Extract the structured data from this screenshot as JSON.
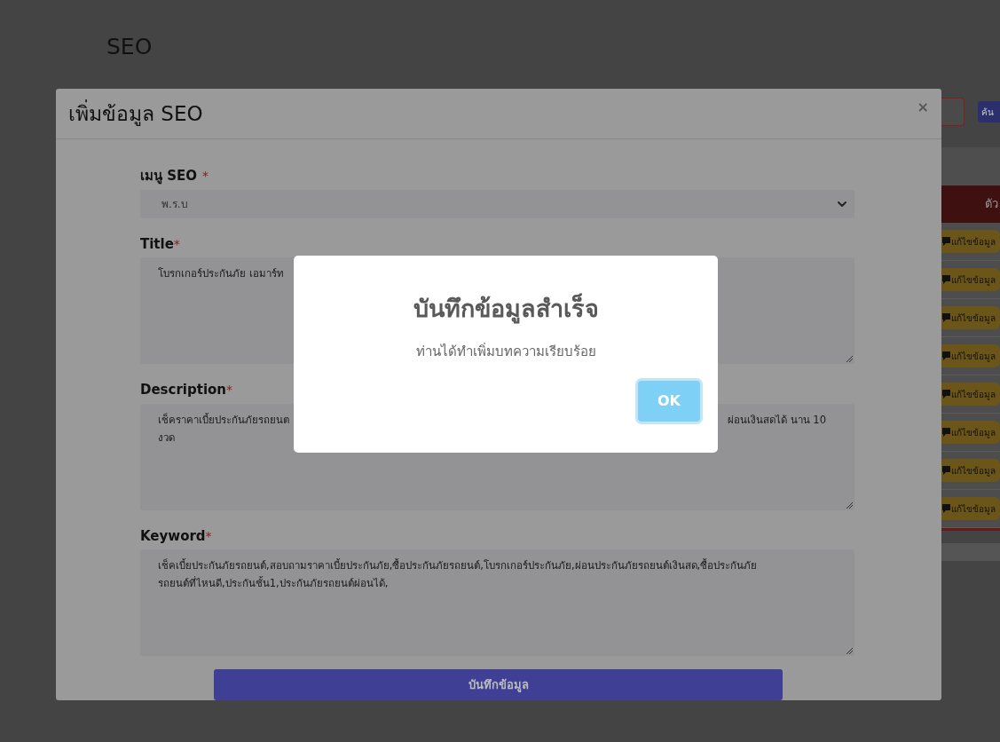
{
  "page": {
    "title": "SEO",
    "search_button": "ค้น",
    "table_header": "ตัว",
    "row_buttons": [
      "แก้ไขข้อมูล",
      "แก้ไขข้อมูล",
      "แก้ไขข้อมูล",
      "แก้ไขข้อมูล",
      "แก้ไขข้อมูล",
      "แก้ไขข้อมูล",
      "แก้ไขข้อมูล",
      "แก้ไขข้อมูล"
    ]
  },
  "modal": {
    "title": "เพิ่มข้อมูล SEO",
    "close": "×",
    "fields": [
      {
        "kind": "select",
        "label": "เมนู SEO",
        "marker": "*",
        "value": "พ.ร.บ"
      },
      {
        "kind": "textarea",
        "label": "Title",
        "marker": "*",
        "lines": [
          {
            "left": "โบรกเกอร์ประกันภัย เอมาร์ท"
          }
        ]
      },
      {
        "kind": "textarea",
        "label": "Description",
        "marker": "*",
        "lines": [
          {
            "left": "เช็คราคาเบี้ยประกันภัยรถยนต",
            "right": "ผ่อนเงินสดได้ นาน 10"
          },
          {
            "left": "งวด"
          }
        ]
      },
      {
        "kind": "textarea",
        "label": "Keyword",
        "marker": "*",
        "lines": [
          {
            "left": "เช็คเบี้ยประกันภัยรถยนต์,สอบถามราคาเบี้ยประกันภัย,ซื้อประกันภัยรถยนต์,โบรกเกอร์ประกันภัย,ผ่อนประกันภัยรถยนต์เงินสด,ซื้อประกันภัย"
          },
          {
            "left": "รถยนต์ที่ไหนดี,ประกันชั้น1,ประกันภัยรถยนต์ผ่อนได้,"
          }
        ]
      }
    ],
    "submit": "บันทึกข้อมูล"
  },
  "alert": {
    "title": "บันทึกข้อมูลสำเร็จ",
    "message": "ท่านได้ทำเพิ่มบทความเรียบร้อย",
    "button": "OK"
  }
}
